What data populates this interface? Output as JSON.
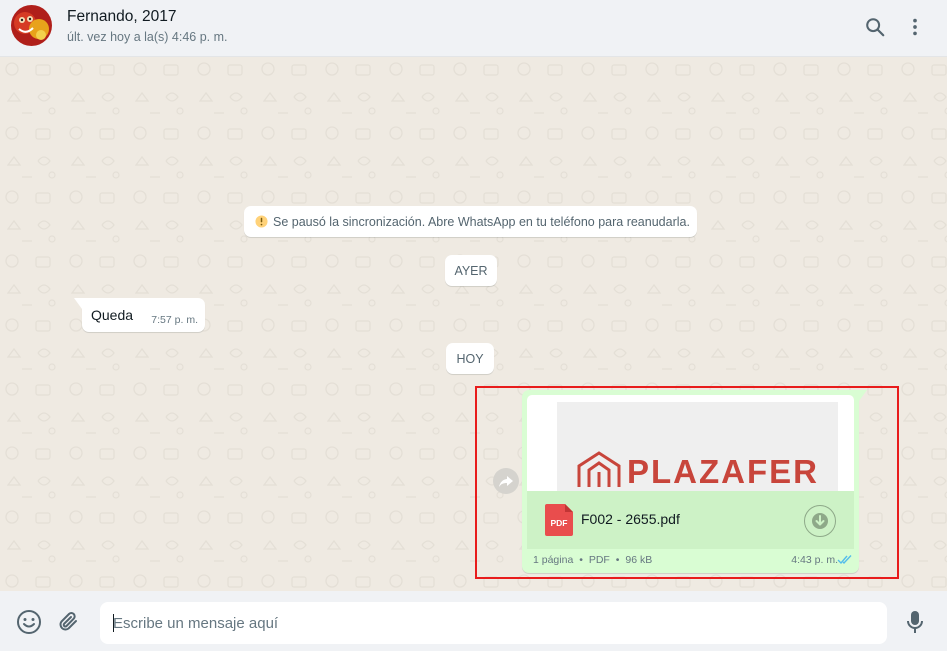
{
  "header": {
    "contact_name": "Fernando, 2017",
    "last_seen": "últ. vez hoy a la(s) 4:46 p. m.",
    "icons": [
      "avatar",
      "search-icon",
      "menu-icon"
    ]
  },
  "chat": {
    "system_message": "Se pausó la sincronización. Abre WhatsApp en tu teléfono para reanudarla.",
    "date_ayer": "AYER",
    "date_hoy": "HOY",
    "incoming_message": {
      "text": "Queda",
      "time": "7:57 p. m."
    },
    "outgoing_document": {
      "preview_brand": "PLAZAFER",
      "file_type_badge": "PDF",
      "file_name": "F002 - 2655.pdf",
      "pages": "1 página",
      "type": "PDF",
      "size": "96 kB",
      "separator": "•",
      "time": "4:43 p. m.",
      "status": "read"
    }
  },
  "composer": {
    "placeholder": "Escribe un mensaje aquí",
    "value": "",
    "icons": [
      "emoji-icon",
      "attach-icon",
      "mic-icon"
    ]
  },
  "colors": {
    "outgoing_bubble": "#d9fdd3",
    "file_row": "#cdf2c6",
    "incoming_bubble": "#ffffff",
    "wallpaper": "#efeae2",
    "pdf_red": "#e94d4d",
    "brand_red": "#c8453b",
    "read_ticks": "#53bdeb",
    "highlight_border": "#e81c1c"
  }
}
